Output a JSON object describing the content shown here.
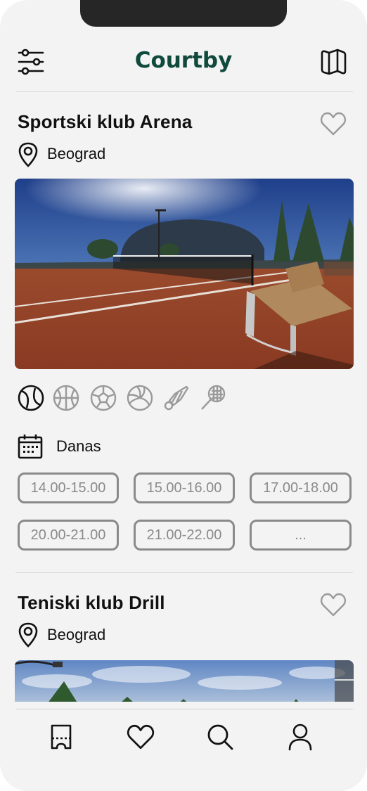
{
  "app": {
    "logo": "Courtby"
  },
  "header": {
    "filter_icon": "sliders-icon",
    "map_icon": "map-icon"
  },
  "clubs": [
    {
      "name": "Sportski klub Arena",
      "city": "Beograd",
      "photo": "clay tennis court with dome hall and bench",
      "sports": [
        "tennis-ball-icon",
        "basketball-icon",
        "football-icon",
        "volleyball-icon",
        "badminton-icon",
        "racket-icon"
      ],
      "day_label": "Danas",
      "slots": [
        "14.00-15.00",
        "15.00-16.00",
        "17.00-18.00",
        "20.00-21.00",
        "21.00-22.00",
        "..."
      ]
    },
    {
      "name": "Teniski klub Drill",
      "city": "Beograd"
    }
  ],
  "tabbar": {
    "items": [
      "tickets-icon",
      "favorites-icon",
      "search-icon",
      "profile-icon"
    ]
  },
  "colors": {
    "brand": "#0f4a3c",
    "background": "#f3f3f3",
    "slot_border": "#8a8a8a"
  }
}
